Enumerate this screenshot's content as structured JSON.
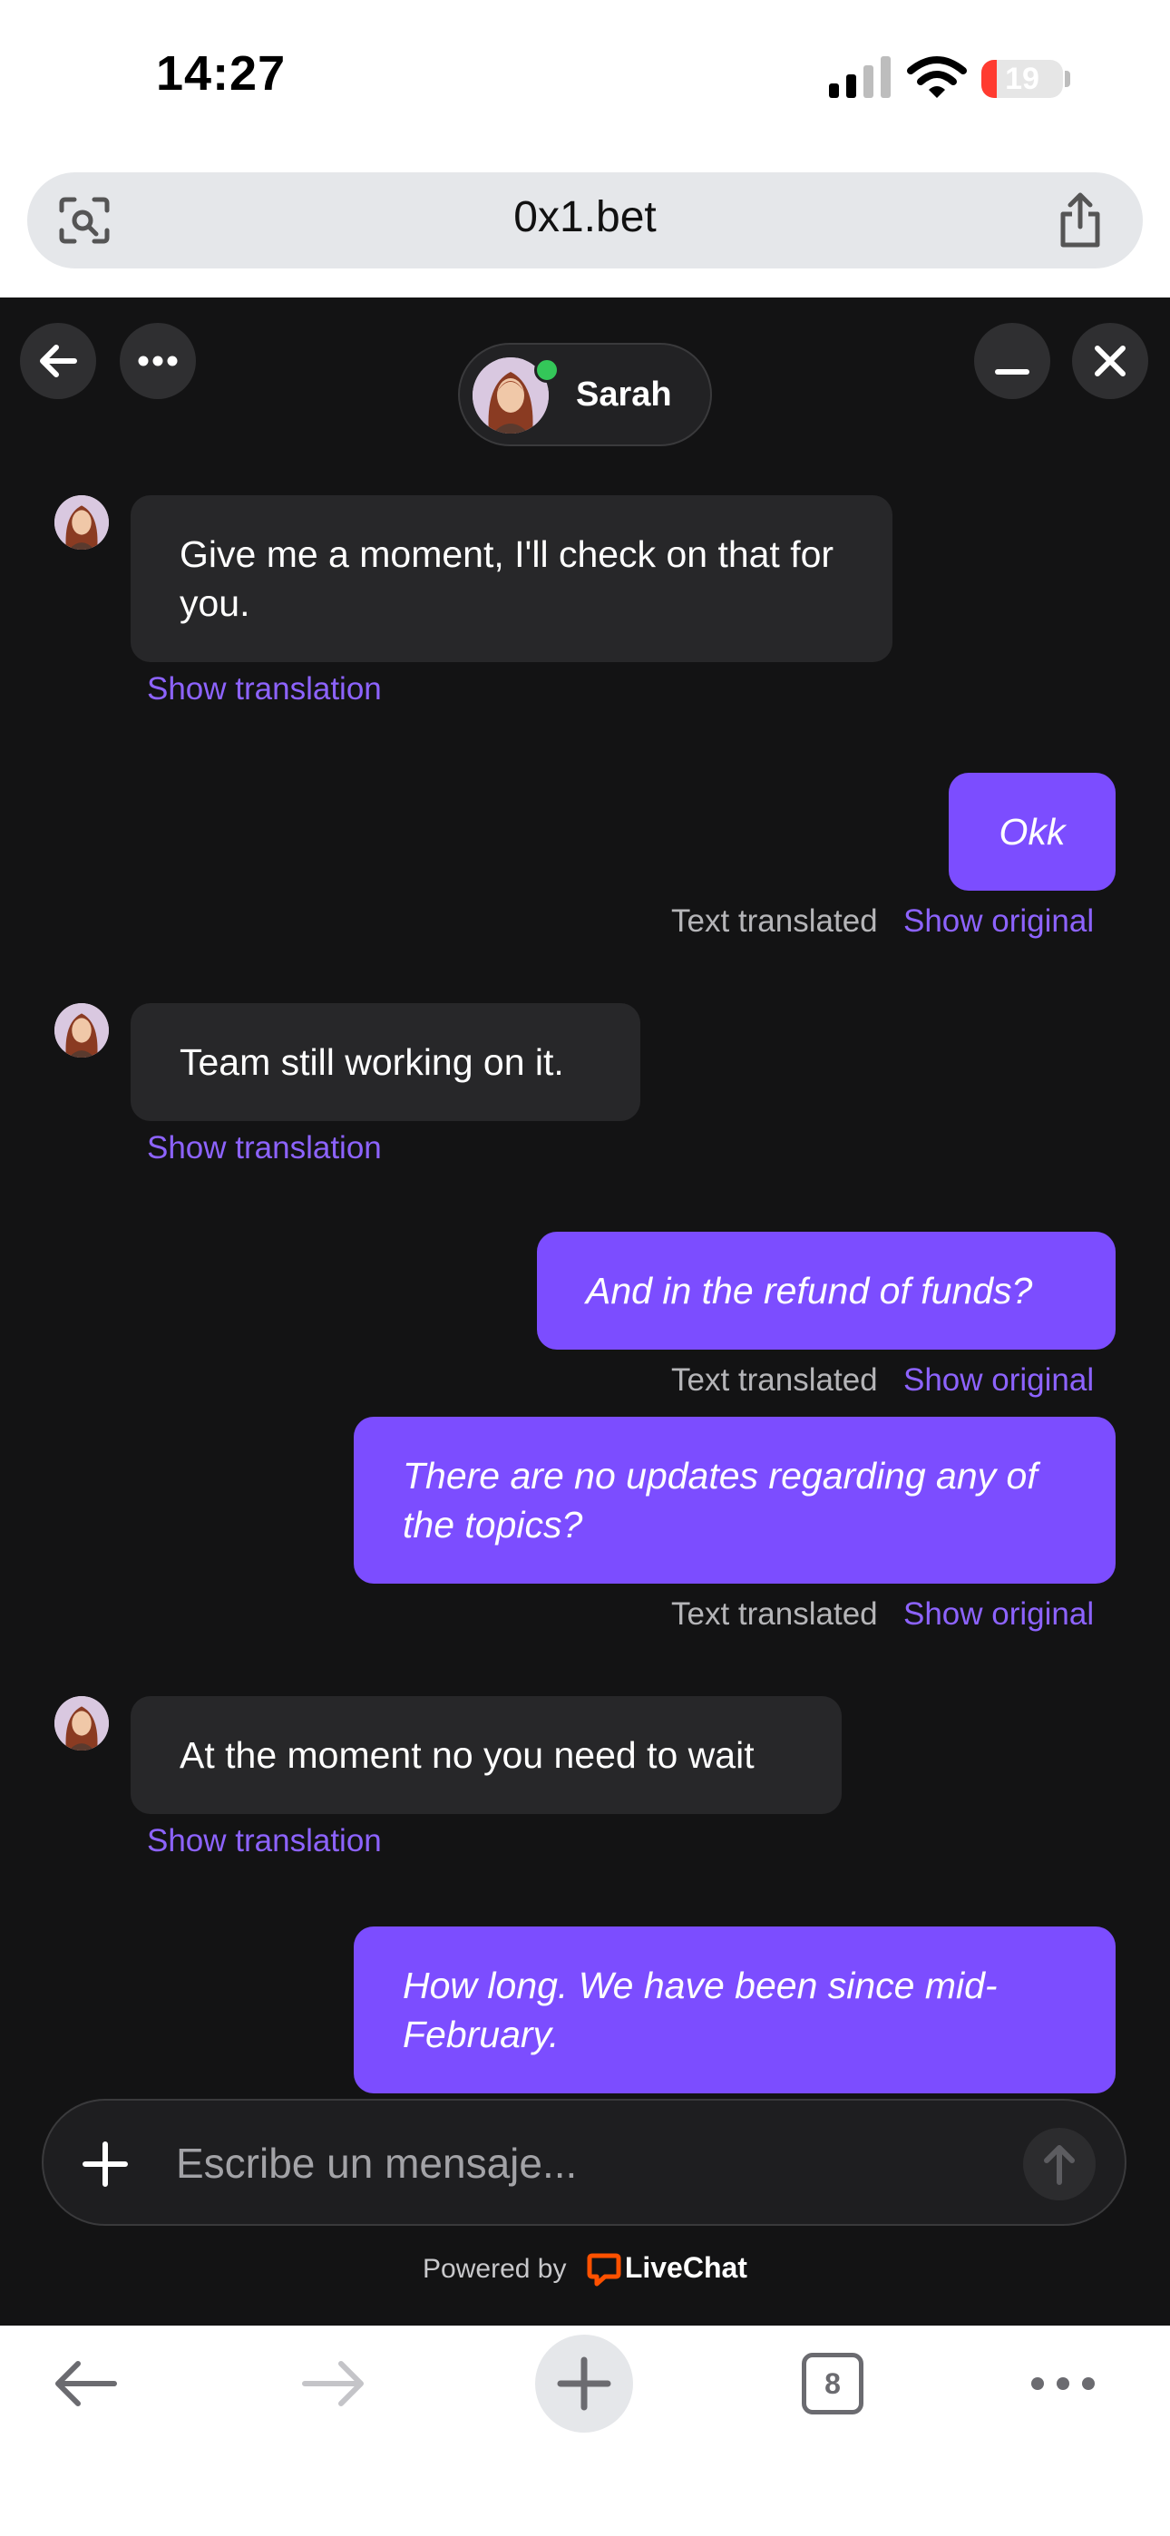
{
  "status_bar": {
    "time": "14:27",
    "battery": "19",
    "battery_level": 0.19
  },
  "browser": {
    "url": "0x1.bet",
    "tab_count": "8"
  },
  "chat": {
    "agent_name": "Sarah",
    "messages": [
      {
        "from": "agent",
        "text": "Give me a moment, I'll check on that for you.",
        "link": "Show translation"
      },
      {
        "from": "user",
        "text": "Okk",
        "meta": "Text translated",
        "link": "Show original"
      },
      {
        "from": "agent",
        "text": "Team still working on it.",
        "link": "Show translation"
      },
      {
        "from": "user",
        "text": "And in the refund of funds?",
        "meta": "Text translated",
        "link": "Show original"
      },
      {
        "from": "user",
        "text": "There are no updates regarding any of the topics?",
        "meta": "Text translated",
        "link": "Show original"
      },
      {
        "from": "agent",
        "text": "At the moment no you need to wait",
        "link": "Show translation"
      },
      {
        "from": "user",
        "text": "How long. We have been since mid-February."
      }
    ],
    "composer_placeholder": "Escribe un mensaje...",
    "powered_by": "Powered by",
    "brand": "LiveChat"
  },
  "colors": {
    "accent": "#7c4dff",
    "link": "#8d63ff",
    "brand_orange": "#ff5100",
    "online": "#34c759",
    "chat_bg": "#131314"
  }
}
